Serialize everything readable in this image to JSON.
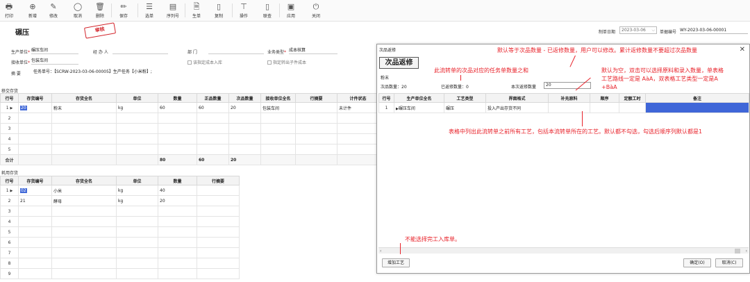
{
  "toolbar": {
    "buttons": [
      {
        "label": "打印",
        "icon": "🖶"
      },
      {
        "label": "新增",
        "icon": "⊕"
      },
      {
        "label": "修改",
        "icon": "✎"
      },
      {
        "label": "取消",
        "icon": "◯"
      },
      {
        "label": "删除",
        "icon": "🗑"
      },
      {
        "label": "保存",
        "icon": "✏"
      },
      {
        "label": "选单",
        "icon": "☰"
      },
      {
        "label": "序列号",
        "icon": "▤"
      },
      {
        "label": "生单",
        "icon": "🗎"
      },
      {
        "label": "复制",
        "icon": "▯"
      },
      {
        "label": "操作",
        "icon": "⊤"
      },
      {
        "label": "联查",
        "icon": "▯"
      },
      {
        "label": "应用",
        "icon": "▣"
      },
      {
        "label": "关闭",
        "icon": "⏻"
      }
    ]
  },
  "header": {
    "title": "碾压",
    "stamp": "审核",
    "date_label": "制单日期",
    "date_value": "2023-03-06",
    "billno_label": "单据编号",
    "billno_value": "WY-2023-03-06-00001",
    "prod_unit_label": "生产单位",
    "prod_unit_value": "碾压车间",
    "agent_label": "经 办 人",
    "dept_label": "部    门",
    "biz_type_label": "业务类型",
    "biz_type_value": "成本核算",
    "recv_unit_label": "接收单位",
    "recv_unit_value": "包装车间",
    "chk_cost_label": "该指定成本入库",
    "chk_sub_label": "指定转出子件成本",
    "summary_label": "摘    要",
    "summary_value": "任务单号：【SCRW-2023-03-06-00005】生产任务【小米粉】;"
  },
  "product_grid": {
    "section_label": "移交存货",
    "headers": [
      "行号",
      "存货编号",
      "存货全名",
      "单位",
      "数量",
      "正品数量",
      "次品数量",
      "接收单位全名",
      "行摘要",
      "计件状态"
    ],
    "rows": [
      {
        "no": "1",
        "code": "20",
        "name": "粉末",
        "unit": "kg",
        "qty": "60",
        "good": "60",
        "defect": "20",
        "recv": "包装车间",
        "memo": "",
        "piece": "未计件"
      },
      {
        "no": "2"
      },
      {
        "no": "3"
      },
      {
        "no": "4"
      },
      {
        "no": "5"
      }
    ],
    "total": {
      "label": "合计",
      "qty": "80",
      "good": "60",
      "defect": "20"
    }
  },
  "material_grid": {
    "section_label": "耗用存货",
    "headers": [
      "行号",
      "存货编号",
      "存货全名",
      "单位",
      "数量",
      "行摘要"
    ],
    "rows": [
      {
        "no": "1",
        "code": "02",
        "name": "小米",
        "unit": "kg",
        "qty": "40"
      },
      {
        "no": "2",
        "code": "21",
        "name": "酵母",
        "unit": "kg",
        "qty": "20"
      },
      {
        "no": "3"
      },
      {
        "no": "4"
      },
      {
        "no": "5"
      },
      {
        "no": "6"
      },
      {
        "no": "7"
      },
      {
        "no": "8"
      },
      {
        "no": "9"
      }
    ]
  },
  "dialog": {
    "title": "次品返修",
    "heading": "次品返修",
    "product": "粉末",
    "defect_qty_label": "次品数量：20",
    "repaired_label": "已返修数量：0",
    "current_label": "本次返修数量",
    "current_value": "20",
    "headers": [
      "行号",
      "生产单位全名",
      "工艺类型",
      "界面格式",
      "补充原料",
      "顺序",
      "定额工时",
      "备注"
    ],
    "rows": [
      {
        "no": "1",
        "unit": "碾压车间",
        "proc": "碾压",
        "format": "投入产出存货不同",
        "material": "",
        "order": "",
        "hours": ""
      }
    ],
    "add_btn": "增加工艺",
    "ok_btn": "确定(O)",
    "cancel_btn": "取消(C)"
  },
  "annotations": {
    "a1": "默认等于次品数量 - 已返修数量，用户可以修改。累计返修数量不要超过次品数量",
    "a2": "此流转单的次品对应的任务单数量之和",
    "a3": "默认为空，双击可以选择原料和录入数量，单表格",
    "a3b": "工艺路线一定是 AàA，双表格工艺类型一定是A",
    "a3c": "+BàA",
    "a4": "表格中列出此流转单之前所有工艺，包括本流转单所在的工艺。默认都不勾选，勾选后顺序列默认都是1",
    "a5": "不能选择完工入库单。"
  }
}
